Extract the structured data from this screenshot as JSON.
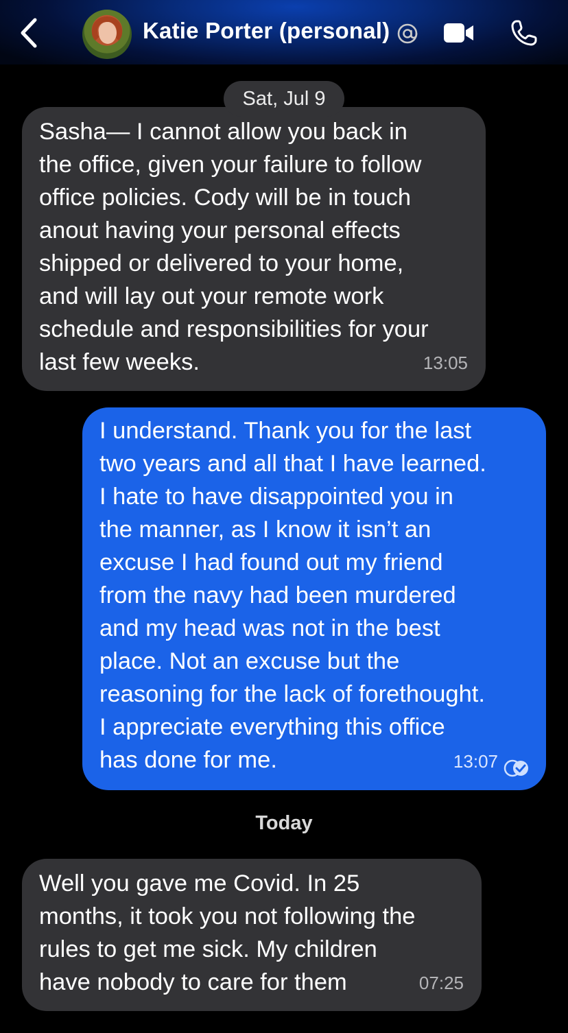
{
  "header": {
    "contact_name": "Katie Porter (personal)",
    "icons": [
      "chevron-left-icon",
      "avatar",
      "at-sign-icon",
      "video-camera-icon",
      "phone-icon"
    ],
    "gradient_colors": [
      "#0b3fae",
      "#03113a"
    ]
  },
  "messages": [
    {
      "date_label": "Sat, Jul 9",
      "direction": "incoming",
      "text": "Sasha— I cannot allow you back in\nthe office, given your failure to follow\noffice policies. Cody will be in touch\nanout having your personal effects\nshipped or delivered to your home,\nand will lay out your remote work\nschedule and responsibilities for your\nlast few weeks.",
      "time": "13:05"
    },
    {
      "direction": "outgoing",
      "text": "I understand. Thank you for the last\ntwo years and all that I have learned.\nI hate to have disappointed you in\nthe manner, as I know it isn’t an\nexcuse I had found out my friend\nfrom the navy had been murdered\nand my head was not in the best\nplace. Not an excuse but the\nreasoning for the lack of forethought.\nI appreciate everything this office\nhas done for me.",
      "time": "13:07",
      "status_icon": "read-check-icon"
    },
    {
      "date_label": "Today",
      "direction": "incoming",
      "text": "Well you gave me Covid. In 25\nmonths, it took you not following the\nrules to get me sick. My children\nhave nobody to care for them",
      "time": "07:25"
    }
  ],
  "colors": {
    "background": "#000000",
    "incoming_bubble": "#333336",
    "outgoing_bubble": "#1b63e8"
  }
}
